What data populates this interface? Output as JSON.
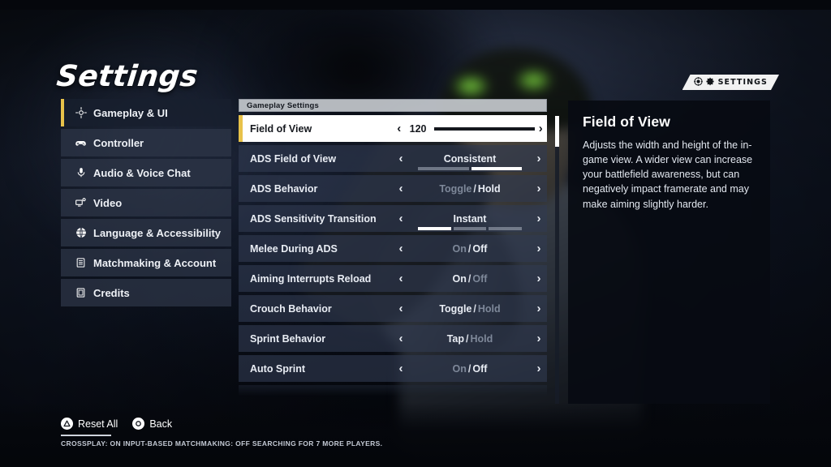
{
  "page_title": "Settings",
  "badge": {
    "label": "SETTINGS",
    "logo_icon": "game-logo-icon",
    "gear_icon": "gear-icon"
  },
  "sidebar": {
    "items": [
      {
        "label": "Gameplay & UI",
        "icon": "crosshair-icon",
        "active": true
      },
      {
        "label": "Controller",
        "icon": "gamepad-icon",
        "active": false
      },
      {
        "label": "Audio & Voice Chat",
        "icon": "microphone-icon",
        "active": false
      },
      {
        "label": "Video",
        "icon": "monitor-icon",
        "active": false
      },
      {
        "label": "Language & Accessibility",
        "icon": "globe-icon",
        "active": false
      },
      {
        "label": "Matchmaking & Account",
        "icon": "list-icon",
        "active": false
      },
      {
        "label": "Credits",
        "icon": "document-icon",
        "active": false
      }
    ]
  },
  "settings_panel": {
    "header": "Gameplay Settings",
    "left_arrow": "‹",
    "right_arrow": "›",
    "rows": [
      {
        "label": "Field of View",
        "type": "slider",
        "value": "120",
        "fill_percent": 100,
        "selected": true
      },
      {
        "label": "ADS Field of View",
        "type": "segmented",
        "value": "Consistent",
        "segments": 2,
        "active_segment": 2,
        "selected": false
      },
      {
        "label": "ADS Behavior",
        "type": "toggle",
        "option_a": "Toggle",
        "option_b": "Hold",
        "separator": "/",
        "active_option": "b",
        "selected": false
      },
      {
        "label": "ADS Sensitivity Transition",
        "type": "segmented",
        "value": "Instant",
        "segments": 3,
        "active_segment": 1,
        "selected": false
      },
      {
        "label": "Melee During ADS",
        "type": "toggle",
        "option_a": "On",
        "option_b": "Off",
        "separator": "/",
        "active_option": "b",
        "selected": false
      },
      {
        "label": "Aiming Interrupts Reload",
        "type": "toggle",
        "option_a": "On",
        "option_b": "Off",
        "separator": "/",
        "active_option": "a",
        "selected": false
      },
      {
        "label": "Crouch Behavior",
        "type": "toggle",
        "option_a": "Toggle",
        "option_b": "Hold",
        "separator": "/",
        "active_option": "a",
        "selected": false
      },
      {
        "label": "Sprint Behavior",
        "type": "toggle",
        "option_a": "Tap",
        "option_b": "Hold",
        "separator": "/",
        "active_option": "a",
        "selected": false
      },
      {
        "label": "Auto Sprint",
        "type": "toggle",
        "option_a": "On",
        "option_b": "Off",
        "separator": "/",
        "active_option": "b",
        "selected": false
      }
    ]
  },
  "description": {
    "title": "Field of View",
    "body": "Adjusts the width and height of the in-game view. A wider view can increase your battlefield awareness, but can negatively impact framerate and may make aiming slightly harder."
  },
  "bottom_bar": {
    "prompts": [
      {
        "label": "Reset All",
        "button": "triangle-button"
      },
      {
        "label": "Back",
        "button": "circle-button"
      }
    ],
    "status": "CROSSPLAY: ON  INPUT-BASED MATCHMAKING: OFF  SEARCHING FOR 7 MORE PLAYERS."
  },
  "colors": {
    "accent": "#e8c24a",
    "selected_row_bg": "#ffffff",
    "panel_bg": "#303a50",
    "description_bg": "#080b12"
  }
}
